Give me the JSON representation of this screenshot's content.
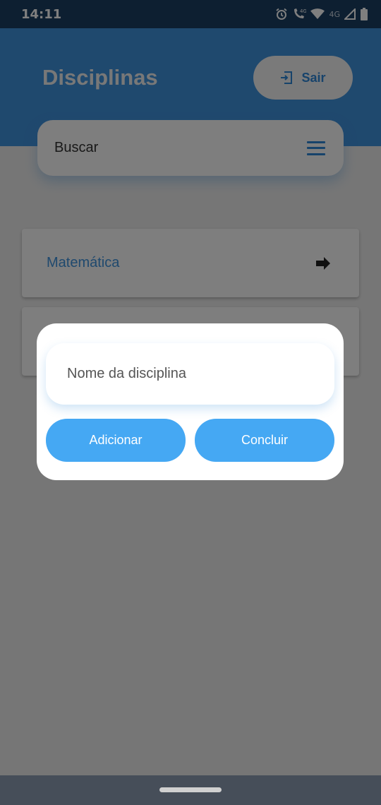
{
  "status_bar": {
    "time": "14:11",
    "network_label": "4G",
    "call_network_label": "4G",
    "icons": [
      "alarm-icon",
      "wifi-call-icon",
      "wifi-icon",
      "signal-icon",
      "battery-icon"
    ]
  },
  "header": {
    "title": "Disciplinas",
    "logout_label": "Sair"
  },
  "search": {
    "placeholder": "Buscar"
  },
  "list": {
    "items": [
      {
        "label": "Matemática"
      },
      {
        "label": ""
      }
    ]
  },
  "dialog": {
    "name_placeholder": "Nome da disciplina",
    "add_label": "Adicionar",
    "done_label": "Concluir"
  },
  "colors": {
    "header": "#3f92dc",
    "accent": "#2f86d6",
    "button": "#45a8f3",
    "status_bar": "#1b3f63",
    "nav_bar": "#464e59"
  }
}
